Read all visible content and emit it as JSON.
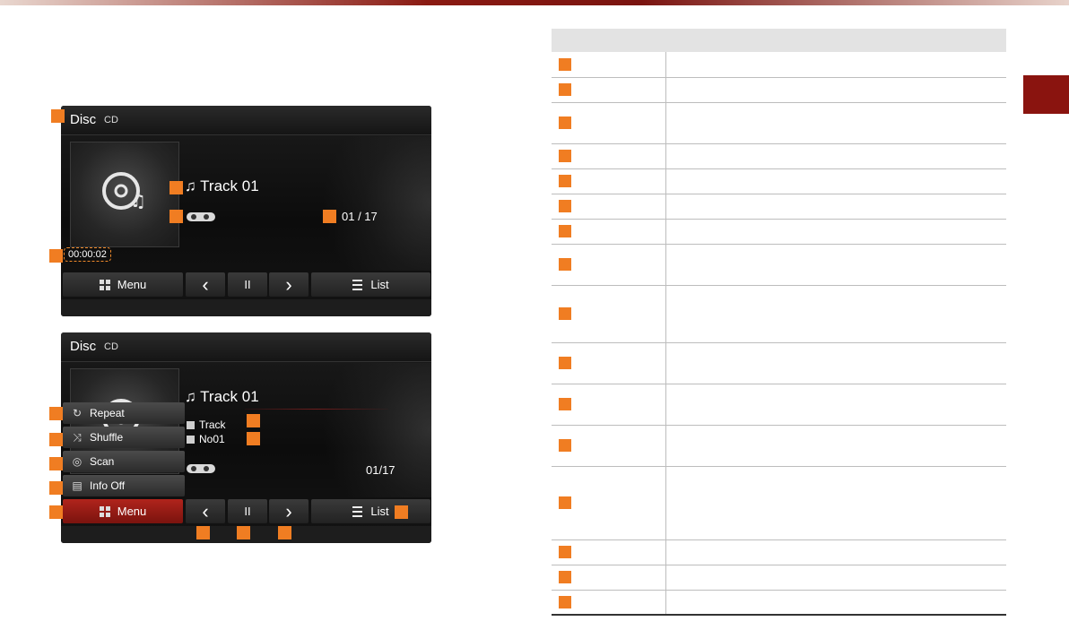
{
  "screen1": {
    "title": "Disc",
    "source": "CD",
    "track": "♫ Track 01",
    "counter": "01 / 17",
    "time": "00:00:02",
    "menu_label": "Menu",
    "prev_icon": "‹",
    "pause_icon": "II",
    "next_icon": "›",
    "list_label": "List"
  },
  "screen2": {
    "title": "Disc",
    "source": "CD",
    "track": "♫ Track 01",
    "counter": "01/17",
    "info_track": "Track",
    "info_no": "No01",
    "popup": [
      "Repeat",
      "Shuffle",
      "Scan",
      "Info Off"
    ],
    "menu_label": "Menu",
    "prev_icon": "‹",
    "pause_icon": "II",
    "next_icon": "›",
    "list_label": "List"
  },
  "colors": {
    "accent_orange": "#f07d22",
    "brand_red": "#8a140f"
  },
  "table": {
    "header": [
      "",
      ""
    ],
    "rows": [
      {
        "h": 28
      },
      {
        "h": 28
      },
      {
        "h": 46
      },
      {
        "h": 28
      },
      {
        "h": 28
      },
      {
        "h": 28
      },
      {
        "h": 28
      },
      {
        "h": 46
      },
      {
        "h": 64
      },
      {
        "h": 46
      },
      {
        "h": 46
      },
      {
        "h": 46
      },
      {
        "h": 82
      },
      {
        "h": 28
      },
      {
        "h": 28
      },
      {
        "h": 28
      }
    ]
  }
}
